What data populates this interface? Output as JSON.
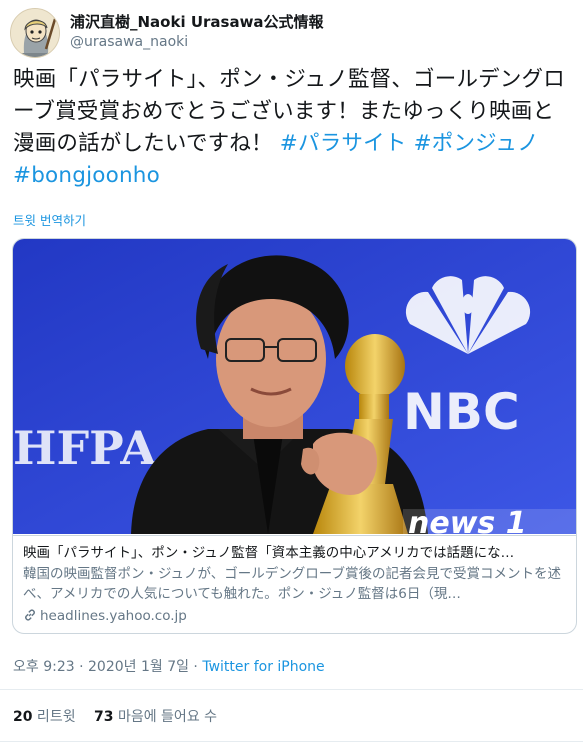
{
  "user": {
    "display_name": "浦沢直樹_Naoki Urasawa公式情報",
    "handle": "@urasawa_naoki"
  },
  "tweet": {
    "text": "映画「パラサイト」、ポン・ジュノ監督、ゴールデングローブ賞受賞おめでとうございます！またゆっくり映画と漫画の話がしたいですね！ ",
    "hashtags": [
      "#パラサイト",
      "#ポンジュノ",
      "#bongjoonho"
    ],
    "translate_label": "트윗 번역하기"
  },
  "card": {
    "image_texts": {
      "left_logo": "HFPA",
      "right_logo": "NBC",
      "watermark": "news 1"
    },
    "title": "映画「パラサイト」、ポン・ジュノ監督「資本主義の中心アメリカでは話題にな…",
    "description": "韓国の映画監督ポン・ジュノが、ゴールデングローブ賞後の記者会見で受賞コメントを述べ、アメリカでの人気についても触れた。ポン・ジュノ監督は6日（現…",
    "domain": "headlines.yahoo.co.jp",
    "domain_icon": "link-icon"
  },
  "meta": {
    "time": "오후 9:23 · 2020년 1월 7일 · ",
    "source": "Twitter for iPhone"
  },
  "stats": {
    "retweets_count": "20",
    "retweets_label": " 리트윗",
    "likes_count": "73",
    "likes_label": " 마음에 들어요 수"
  },
  "colors": {
    "link": "#1b95e0",
    "secondary_text": "#657786",
    "border": "#ccd6dd",
    "card_bg": "#2a3ed0"
  }
}
